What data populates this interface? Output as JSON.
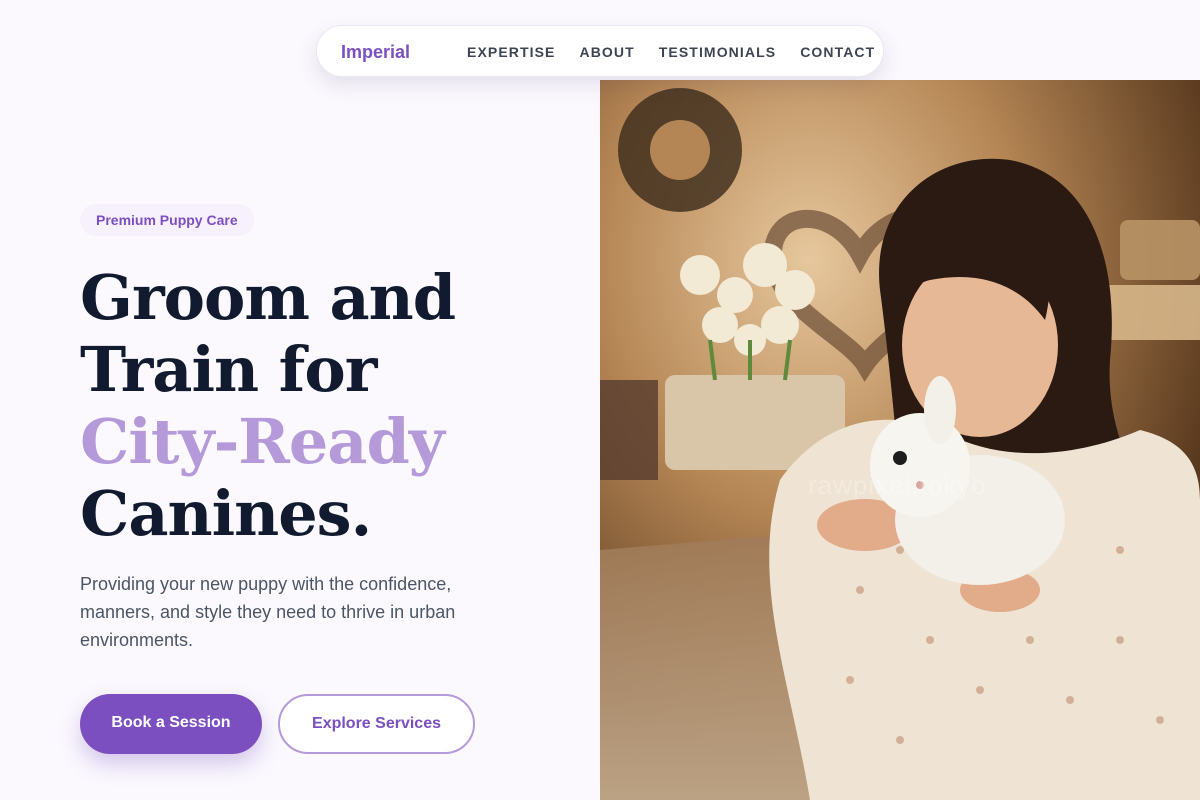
{
  "nav": {
    "brand": "Imperial",
    "links": [
      "EXPERTISE",
      "ABOUT",
      "TESTIMONIALS",
      "CONTACT"
    ]
  },
  "hero": {
    "badge": "Premium Puppy Care",
    "headline": {
      "line1": "Groom and",
      "line2": "Train for",
      "accent": "City-Ready",
      "line4": "Canines."
    },
    "subtext": "Providing your new puppy with the confidence, manners, and style they need to thrive in urban environments.",
    "primary_cta": "Book a Session",
    "secondary_cta": "Explore Services",
    "image_watermark": "rawpixel.tokyo"
  },
  "colors": {
    "accent": "#7b4fc0",
    "accent_light": "#b59ad9",
    "headline": "#111a2f",
    "background": "#fbf9fe"
  }
}
